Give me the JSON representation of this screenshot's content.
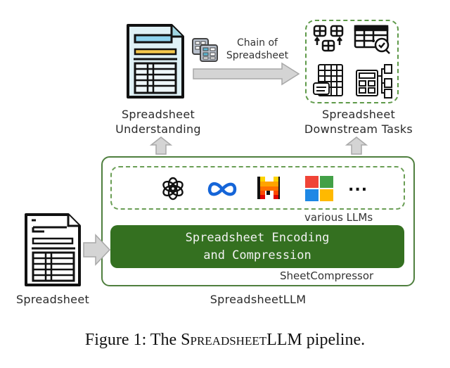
{
  "figure": {
    "input_label": "Spreadsheet",
    "understanding_label": [
      "Spreadsheet",
      "Understanding"
    ],
    "chain_label": [
      "Chain of",
      "Spreadsheet"
    ],
    "downstream_label": [
      "Spreadsheet",
      "Downstream Tasks"
    ],
    "llms_label": "various LLMs",
    "llm_icons": [
      "openai-icon",
      "meta-icon",
      "mistral-icon",
      "microsoft-icon",
      "ellipsis-icon"
    ],
    "ellipsis": "...",
    "encoding_label": [
      "Spreadsheet Encoding",
      "and Compression"
    ],
    "compressor_label": "SheetCompressor",
    "system_label": "SpreadsheetLLM",
    "colors": {
      "green_dark": "#347020",
      "green_border": "#4f7f3e",
      "green_dash": "#6a9e55",
      "arrow_gray": "#d4d4d4",
      "ms_red": "#f25022",
      "ms_green": "#43a047",
      "ms_blue": "#1e88e5",
      "ms_yellow": "#ffb900",
      "meta_blue": "#1565d8"
    }
  },
  "caption": {
    "prefix": "Figure 1: The ",
    "s": "S",
    "preadsheet": "preadsheet",
    "llm": "LLM",
    "suffix": " pipeline."
  }
}
